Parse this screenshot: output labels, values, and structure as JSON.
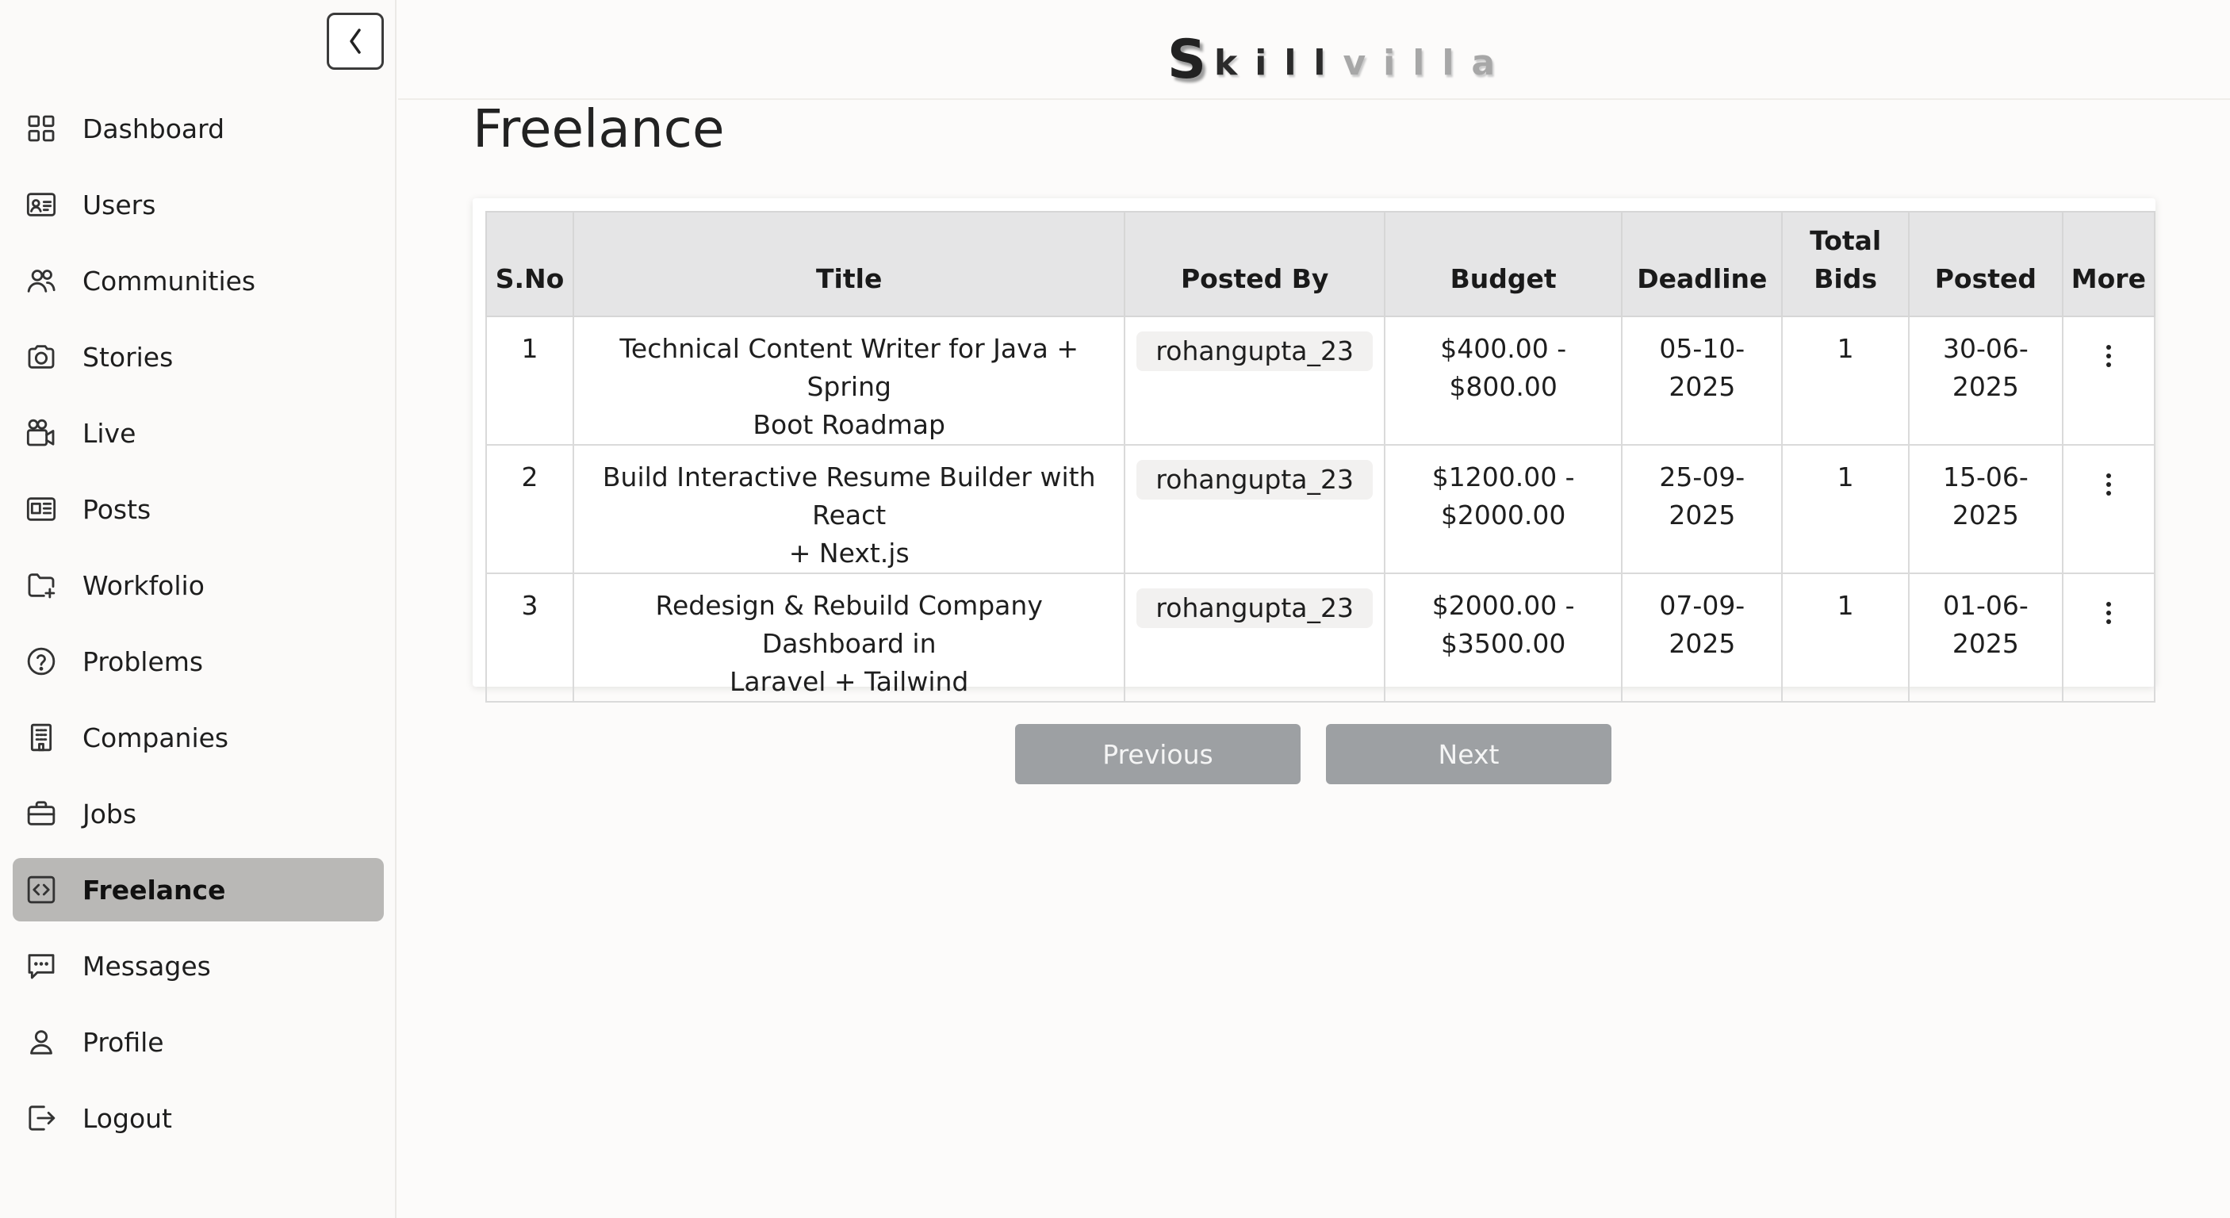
{
  "brand": {
    "logo_initial": "S",
    "logo_dark": "kill",
    "logo_light": "villa"
  },
  "sidebar": {
    "items": [
      {
        "label": "Dashboard",
        "icon": "grid-icon"
      },
      {
        "label": "Users",
        "icon": "id-card-icon"
      },
      {
        "label": "Communities",
        "icon": "people-icon"
      },
      {
        "label": "Stories",
        "icon": "camera-icon"
      },
      {
        "label": "Live",
        "icon": "video-camera-icon"
      },
      {
        "label": "Posts",
        "icon": "newspaper-icon"
      },
      {
        "label": "Workfolio",
        "icon": "folder-plus-icon"
      },
      {
        "label": "Problems",
        "icon": "question-circle-icon"
      },
      {
        "label": "Companies",
        "icon": "building-icon"
      },
      {
        "label": "Jobs",
        "icon": "briefcase-icon"
      },
      {
        "label": "Freelance",
        "icon": "code-window-icon",
        "active": true
      },
      {
        "label": "Messages",
        "icon": "chat-icon"
      },
      {
        "label": "Profile",
        "icon": "person-icon"
      },
      {
        "label": "Logout",
        "icon": "logout-icon"
      }
    ]
  },
  "page": {
    "title": "Freelance"
  },
  "table": {
    "headers": {
      "sno": "S.No",
      "title": "Title",
      "posted_by": "Posted By",
      "budget": "Budget",
      "deadline": "Deadline",
      "total_bids_1": "Total",
      "total_bids_2": "Bids",
      "posted": "Posted",
      "more": "More"
    },
    "rows": [
      {
        "sno": "1",
        "title_1": "Technical Content Writer for Java + Spring",
        "title_2": "Boot Roadmap",
        "posted_by": "rohangupta_23",
        "budget_1": "$400.00 -",
        "budget_2": "$800.00",
        "deadline_1": "05-10-",
        "deadline_2": "2025",
        "bids": "1",
        "posted_1": "30-06-",
        "posted_2": "2025"
      },
      {
        "sno": "2",
        "title_1": "Build Interactive Resume Builder with React",
        "title_2": "+ Next.js",
        "posted_by": "rohangupta_23",
        "budget_1": "$1200.00 -",
        "budget_2": "$2000.00",
        "deadline_1": "25-09-",
        "deadline_2": "2025",
        "bids": "1",
        "posted_1": "15-06-",
        "posted_2": "2025"
      },
      {
        "sno": "3",
        "title_1": "Redesign & Rebuild Company Dashboard in",
        "title_2": "Laravel + Tailwind",
        "posted_by": "rohangupta_23",
        "budget_1": "$2000.00 -",
        "budget_2": "$3500.00",
        "deadline_1": "07-09-",
        "deadline_2": "2025",
        "bids": "1",
        "posted_1": "01-06-",
        "posted_2": "2025"
      }
    ]
  },
  "pagination": {
    "previous_label": "Previous",
    "next_label": "Next"
  }
}
